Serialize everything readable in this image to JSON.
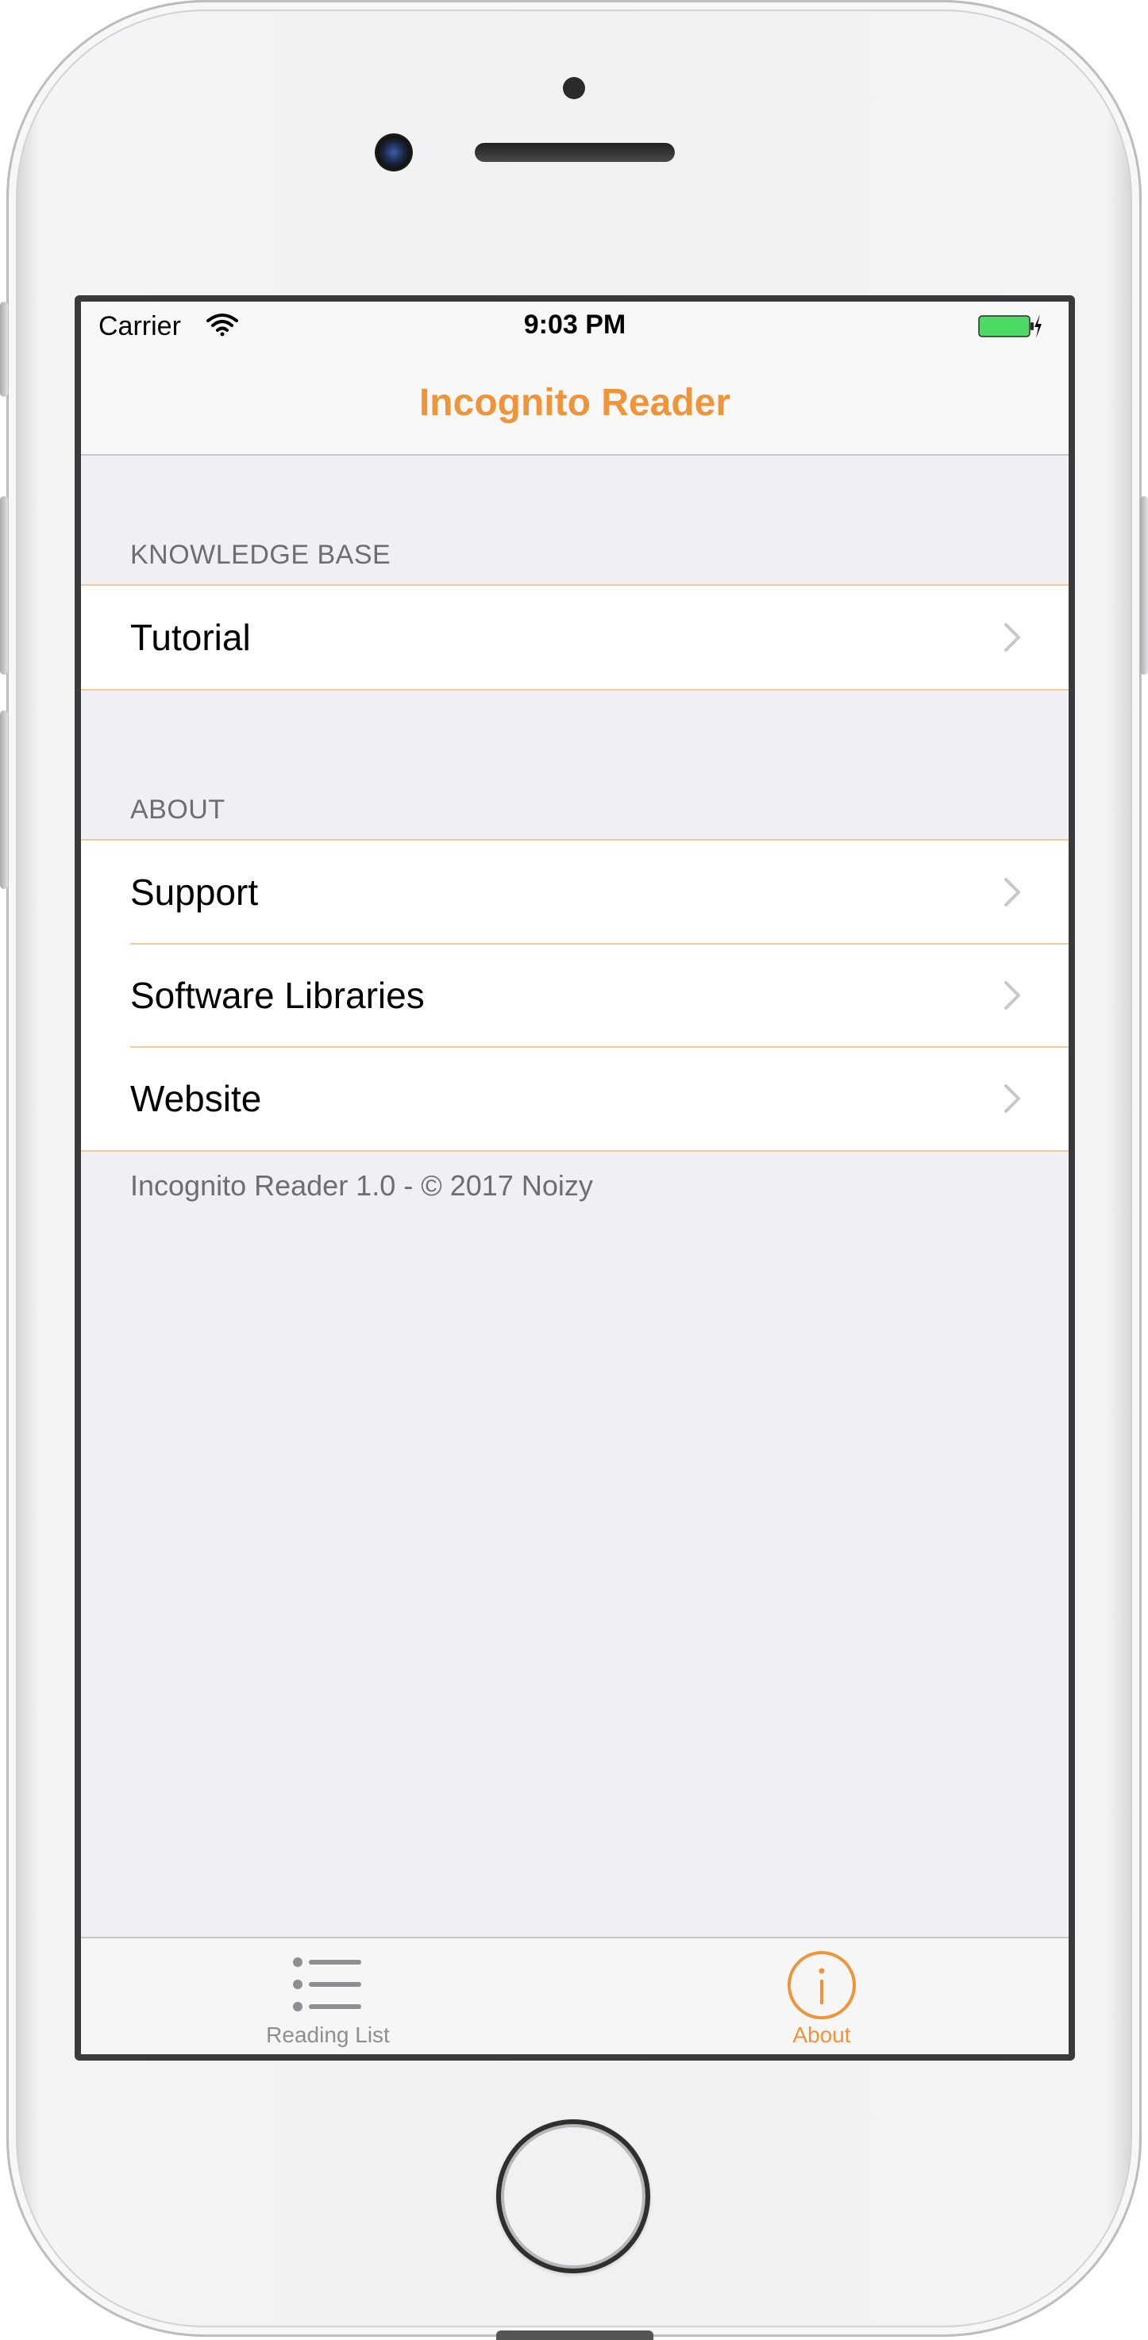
{
  "status_bar": {
    "carrier": "Carrier",
    "time": "9:03 PM"
  },
  "nav": {
    "title": "Incognito Reader"
  },
  "sections": [
    {
      "header": "KNOWLEDGE BASE",
      "rows": [
        {
          "label": "Tutorial"
        }
      ]
    },
    {
      "header": "ABOUT",
      "rows": [
        {
          "label": "Support"
        },
        {
          "label": "Software Libraries"
        },
        {
          "label": "Website"
        }
      ]
    }
  ],
  "footer": {
    "text": "Incognito Reader 1.0  -  © 2017 Noizy"
  },
  "tab_bar": {
    "tabs": [
      {
        "label": "Reading List",
        "icon": "list-icon",
        "selected": false
      },
      {
        "label": "About",
        "icon": "info-icon",
        "selected": true
      }
    ]
  },
  "colors": {
    "accent": "#f0943a",
    "separator": "#f3c9a0",
    "background": "#efeff4",
    "inactive": "#8e8e93",
    "battery": "#4cd964"
  }
}
